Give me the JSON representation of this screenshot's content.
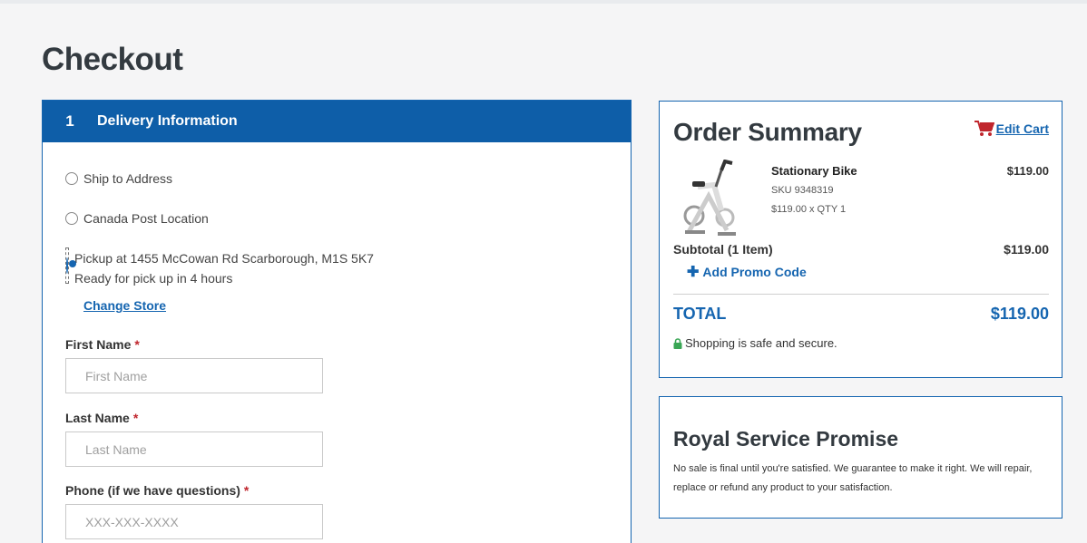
{
  "page": {
    "title": "Checkout"
  },
  "delivery": {
    "step_number": "1",
    "step_title": "Delivery Information",
    "options": [
      {
        "label": "Ship to Address",
        "selected": false
      },
      {
        "label": "Canada Post Location",
        "selected": false
      },
      {
        "label": "Pickup at 1455 McCowan Rd Scarborough, M1S 5K7",
        "sublabel": "Ready for pick up in 4 hours",
        "selected": true
      }
    ],
    "change_store_label": "Change Store",
    "fields": [
      {
        "label": "First Name",
        "required_mark": "*",
        "placeholder": "First Name",
        "value": ""
      },
      {
        "label": "Last Name",
        "required_mark": "*",
        "placeholder": "Last Name",
        "value": ""
      },
      {
        "label": "Phone (if we have questions)",
        "required_mark": "*",
        "placeholder": "XXX-XXX-XXXX",
        "value": ""
      }
    ]
  },
  "summary": {
    "title": "Order Summary",
    "edit_cart_label": "Edit Cart",
    "item": {
      "name": "Stationary Bike",
      "sku": "SKU 9348319",
      "qty_line": "$119.00 x QTY 1",
      "price": "$119.00"
    },
    "subtotal_label": "Subtotal (1 Item)",
    "subtotal_value": "$119.00",
    "promo_label": "Add Promo Code",
    "total_label": "TOTAL",
    "total_value": "$119.00",
    "secure_text": "Shopping is safe and secure."
  },
  "promise": {
    "title": "Royal Service Promise",
    "text": "No sale is final until you're satisfied. We guarantee to make it right. We will repair, replace or refund any product to your satisfaction."
  },
  "colors": {
    "brand_blue": "#1565b0",
    "header_blue": "#0e5ea8",
    "cart_red": "#c0262d",
    "lock_green": "#3aa655"
  },
  "icons": [
    "cart-icon",
    "plus-icon",
    "lock-icon",
    "product-image"
  ]
}
